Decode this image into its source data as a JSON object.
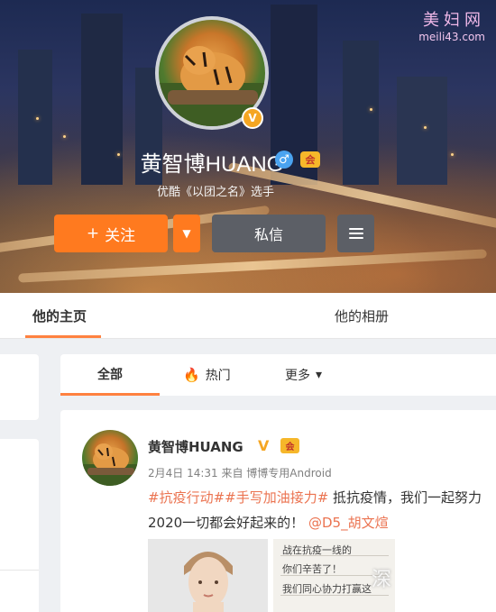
{
  "cover": {
    "watermark_top": "美妇网",
    "watermark_url": "meili43.com"
  },
  "profile": {
    "name": "黄智博HUANG",
    "verified_badge": "V",
    "vip_badge": "会",
    "gender_symbol": "♂",
    "description": "优酷《以团之名》选手",
    "follow_label": "关注",
    "follow_plus": "+",
    "dropdown_symbol": "▼",
    "message_label": "私信"
  },
  "profile_tabs": [
    {
      "label": "他的主页",
      "active": true
    },
    {
      "label": "他的相册",
      "active": false
    }
  ],
  "feed_tabs": {
    "all": "全部",
    "hot": "热门",
    "more": "更多",
    "more_chevron": "▾"
  },
  "post": {
    "author": "黄智博HUANG",
    "verified_badge": "V",
    "vip_badge": "会",
    "meta": "2月4日 14:31 来自 博博专用Android",
    "tag1": "#抗疫行动#",
    "tag2": "#手写加油接力#",
    "text1": " 抵抗疫情，我们一起努力",
    "text2": "2020一切都会好起来的！",
    "mention": "@D5_胡文煊",
    "handwriting": [
      "战在抗疫一线的",
      "你们辛苦了！",
      "我们同心协力打赢这"
    ],
    "watermark": "深"
  },
  "colors": {
    "accent": "#ff8140",
    "follow": "#ff7a1f",
    "gray_button": "#5c5f66",
    "tag": "#eb7350"
  }
}
